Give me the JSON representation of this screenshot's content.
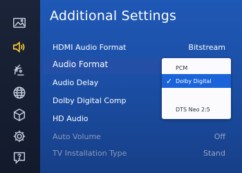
{
  "panel": {
    "title": "Additional Settings"
  },
  "sidebar": {
    "icons": [
      "picture-icon",
      "sound-icon",
      "broadcasting-icon",
      "network-icon",
      "smart-features-icon",
      "general-icon",
      "support-icon"
    ]
  },
  "settings": [
    {
      "label": "HDMI Audio Format",
      "value": "Bitstream",
      "disabled": false
    },
    {
      "label": "Audio Format",
      "value": "",
      "disabled": false,
      "focused": true
    },
    {
      "label": "Audio Delay",
      "value": "",
      "disabled": false
    },
    {
      "label": "Dolby Digital Comp",
      "value": "",
      "disabled": false
    },
    {
      "label": "HD Audio",
      "value": "",
      "disabled": false
    },
    {
      "label": "Auto Volume",
      "value": "Off",
      "disabled": true
    },
    {
      "label": "TV Installation Type",
      "value": "Stand",
      "disabled": true
    }
  ],
  "dropdown": {
    "options": [
      "PCM",
      "Dolby Digital",
      "",
      "DTS Neo 2:5"
    ],
    "selected_index": 1
  },
  "colors": {
    "panel": "#1f58b5",
    "focus_row": "#2350a6",
    "selected_option": "#1a63d8",
    "sidebar": "#1b2438",
    "icon": "#c8d0e0"
  }
}
